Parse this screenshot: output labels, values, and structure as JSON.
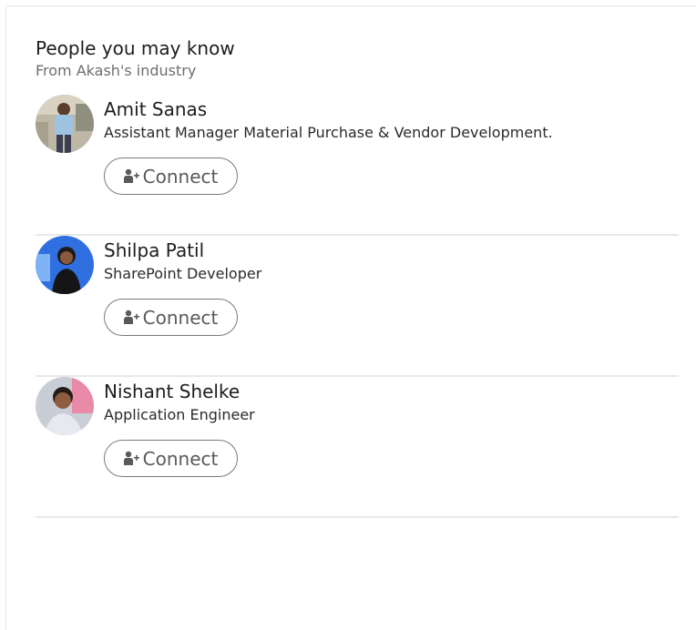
{
  "module": {
    "title": "People you may know",
    "subtitle": "From Akash's industry"
  },
  "people": [
    {
      "name": "Amit Sanas",
      "headline": "Assistant Manager Material Purchase & Vendor Development.",
      "connect_label": "Connect",
      "connect_icon": "add-person-icon"
    },
    {
      "name": "Shilpa Patil",
      "headline": "SharePoint Developer",
      "connect_label": "Connect",
      "connect_icon": "add-person-icon"
    },
    {
      "name": "Nishant Shelke",
      "headline": "Application Engineer",
      "connect_label": "Connect",
      "connect_icon": "add-person-icon"
    }
  ]
}
